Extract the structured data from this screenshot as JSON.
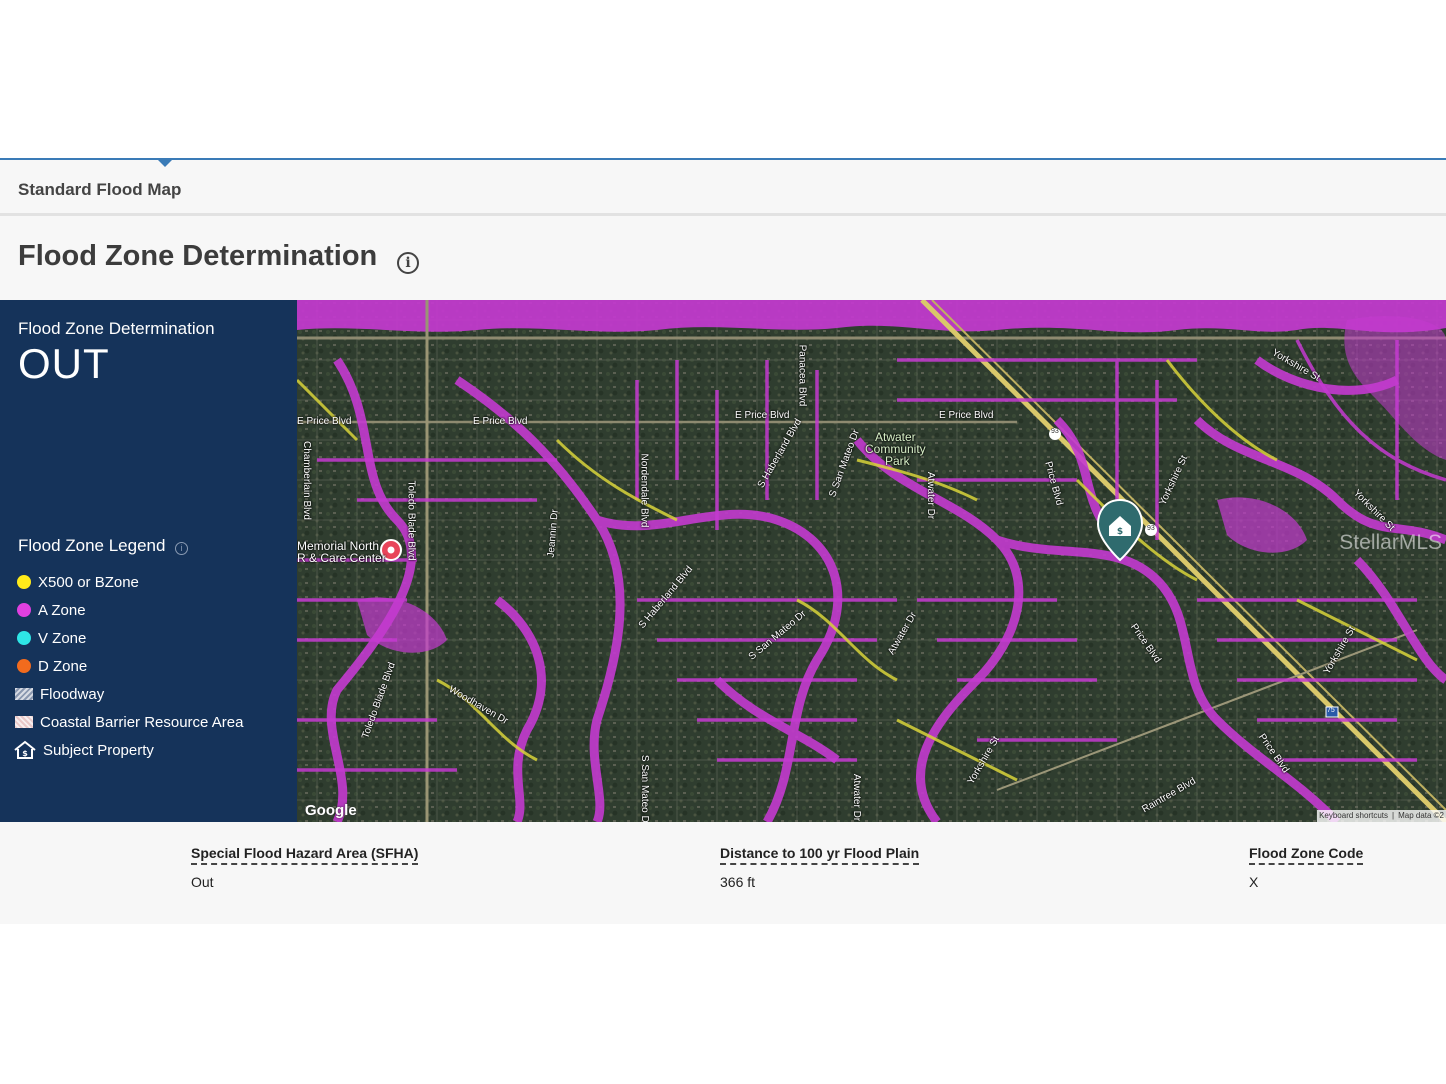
{
  "tab": {
    "label": "Standard Flood Map"
  },
  "heading": {
    "title": "Flood Zone Determination",
    "info_icon": "info-icon"
  },
  "determination": {
    "label": "Flood Zone Determination",
    "value": "OUT"
  },
  "legend": {
    "title": "Flood Zone Legend",
    "items": [
      {
        "label": "X500 or BZone",
        "color": "#ffeb1a",
        "kind": "dot"
      },
      {
        "label": "A Zone",
        "color": "#e040e0",
        "kind": "dot"
      },
      {
        "label": "V Zone",
        "color": "#2ee6e6",
        "kind": "dot"
      },
      {
        "label": "D Zone",
        "color": "#f26b1d",
        "kind": "dot"
      },
      {
        "label": "Floodway",
        "kind": "hatch"
      },
      {
        "label": "Coastal Barrier Resource Area",
        "kind": "cbra"
      },
      {
        "label": "Subject Property",
        "kind": "house-icon"
      }
    ]
  },
  "map": {
    "roads": {
      "e_price_1": "E Price Blvd",
      "e_price_2": "E Price Blvd",
      "e_price_3": "E Price Blvd",
      "chamberlain": "Chamberlain Blvd",
      "toledo_1": "Toledo Blade Blvd",
      "toledo_2": "Toledo Blade Blvd",
      "panacea": "Panacea Blvd",
      "haberland_1": "S Haberland Blvd",
      "haberland_2": "S Haberland Blvd",
      "sanmateo_1": "S San Mateo Dr",
      "sanmateo_2": "S San Mateo Dr",
      "sanmateo_3": "S San Mateo Dr",
      "nordendale": "Nordendale Blvd",
      "jeannin": "Jeannin Dr",
      "atwater_1": "Atwater Dr",
      "atwater_2": "Atwater Dr",
      "atwater_3": "Atwater Dr",
      "price_1": "Price Blvd",
      "price_2": "Price Blvd",
      "price_3": "Price Blvd",
      "yorkshire_1": "Yorkshire St",
      "yorkshire_2": "Yorkshire St",
      "yorkshire_3": "Yorkshire St",
      "yorkshire_4": "Yorkshire St",
      "yorkshire_5": "Yorkshire St",
      "woodhaven": "Woodhaven Dr",
      "raintree": "Raintree Blvd",
      "hwy93a": "93",
      "hwy93b": "93",
      "hwy75": "75"
    },
    "places": {
      "park_line1": "Atwater",
      "park_line2": "Community",
      "park_line3": "Park",
      "hospital_line1": "Memorial North",
      "hospital_line2": "R & Care Center"
    },
    "google": "Google",
    "keyboard_shortcuts": "Keyboard shortcuts",
    "map_data": "Map data ©2",
    "watermark": "StellarMLS"
  },
  "stats": [
    {
      "label": "Special Flood Hazard Area (SFHA)",
      "value": "Out"
    },
    {
      "label": "Distance to 100 yr Flood Plain",
      "value": "366 ft"
    },
    {
      "label": "Flood Zone Code",
      "value": "X"
    }
  ]
}
